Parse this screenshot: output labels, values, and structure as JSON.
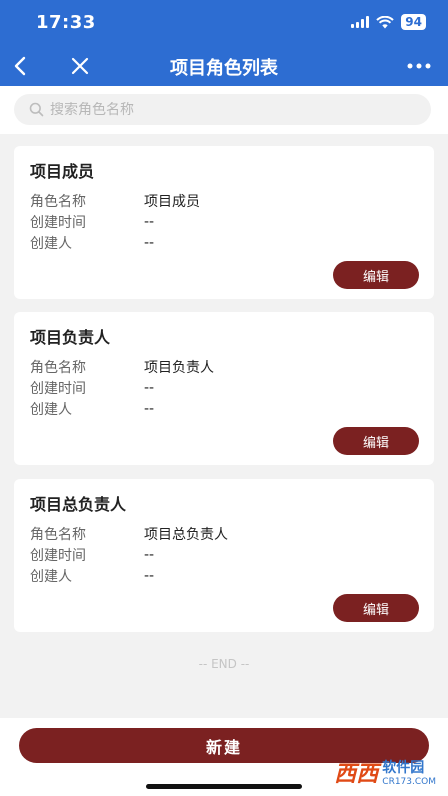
{
  "status_bar": {
    "time": "17:33",
    "battery": "94"
  },
  "nav": {
    "title": "项目角色列表"
  },
  "search": {
    "placeholder": "搜索角色名称"
  },
  "field_labels": {
    "role_name": "角色名称",
    "created_time": "创建时间",
    "creator": "创建人"
  },
  "roles": [
    {
      "title": "项目成员",
      "role_name": "项目成员",
      "created_time": "--",
      "creator": "--",
      "edit_label": "编辑"
    },
    {
      "title": "项目负责人",
      "role_name": "项目负责人",
      "created_time": "--",
      "creator": "--",
      "edit_label": "编辑"
    },
    {
      "title": "项目总负责人",
      "role_name": "项目总负责人",
      "created_time": "--",
      "creator": "--",
      "edit_label": "编辑"
    }
  ],
  "end_text": "-- END --",
  "new_button_label": "新建",
  "watermark": {
    "logo": "西西",
    "name": "软件园",
    "url": "CR173.COM"
  }
}
